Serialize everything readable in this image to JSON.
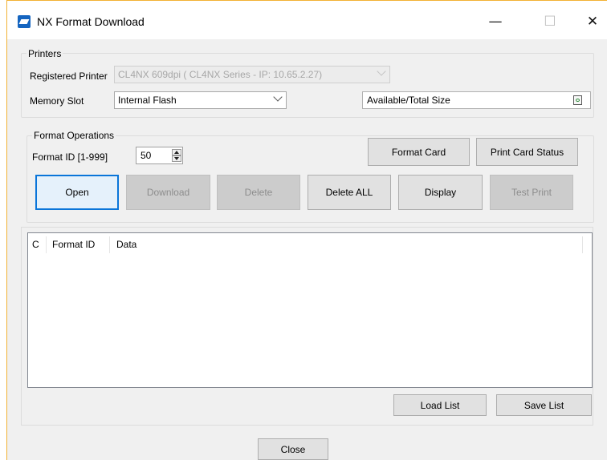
{
  "window": {
    "title": "NX Format Download",
    "controls": {
      "minimize": "—",
      "maximize": "☐",
      "close": "✕"
    }
  },
  "printers": {
    "group_label": "Printers",
    "registered_printer_label": "Registered Printer",
    "registered_printer_value": "CL4NX 609dpi ( CL4NX Series - IP: 10.65.2.27)",
    "memory_slot_label": "Memory Slot",
    "memory_slot_value": "Internal Flash",
    "size_field": "Available/Total Size"
  },
  "format_operations": {
    "group_label": "Format Operations",
    "format_id_label": "Format ID [1-999]",
    "format_id_value": "50",
    "buttons": {
      "format_card": "Format Card",
      "print_card_status": "Print Card Status",
      "open": "Open",
      "download": "Download",
      "delete": "Delete",
      "delete_all": "Delete ALL",
      "display": "Display",
      "test_print": "Test Print"
    }
  },
  "list": {
    "columns": [
      "C",
      "Format ID",
      "Data"
    ]
  },
  "footer": {
    "load_list": "Load List",
    "save_list": "Save List",
    "close": "Close"
  }
}
